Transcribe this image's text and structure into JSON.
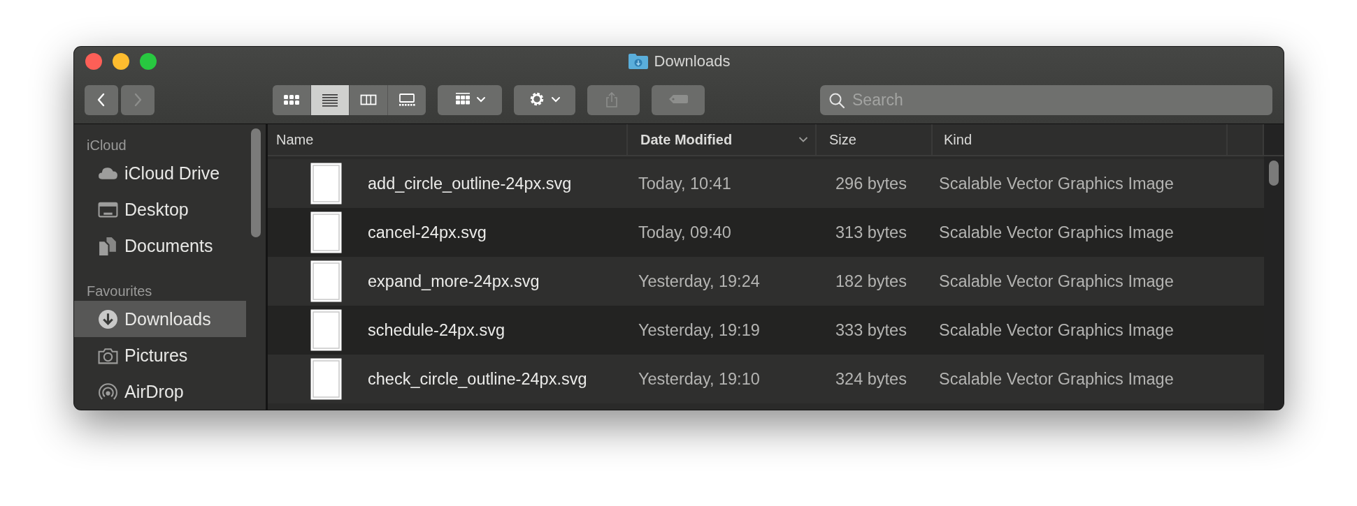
{
  "window": {
    "title": "Downloads"
  },
  "toolbar": {
    "nav": [
      {
        "kind": "back",
        "disabled": false
      },
      {
        "kind": "forward",
        "disabled": true
      }
    ],
    "views": [
      {
        "kind": "icons",
        "selected": false
      },
      {
        "kind": "list",
        "selected": true
      },
      {
        "kind": "columns",
        "selected": false
      },
      {
        "kind": "gallery",
        "selected": false
      }
    ],
    "buttons": [
      {
        "kind": "group",
        "disabled": false
      },
      {
        "kind": "action",
        "disabled": false
      },
      {
        "kind": "share",
        "disabled": true
      },
      {
        "kind": "tag",
        "disabled": true
      }
    ]
  },
  "search": {
    "placeholder": "Search"
  },
  "sidebar": {
    "sections": [
      {
        "title": "iCloud",
        "items": [
          {
            "label": "iCloud Drive",
            "kind": "cloud",
            "selected": false
          },
          {
            "label": "Desktop",
            "kind": "desktop",
            "selected": false
          },
          {
            "label": "Documents",
            "kind": "documents",
            "selected": false
          }
        ]
      },
      {
        "title": "Favourites",
        "items": [
          {
            "label": "Downloads",
            "kind": "downloads",
            "selected": true
          },
          {
            "label": "Pictures",
            "kind": "pictures",
            "selected": false
          },
          {
            "label": "AirDrop",
            "kind": "airdrop",
            "selected": false
          }
        ]
      }
    ]
  },
  "table": {
    "columns": [
      {
        "label": "Name",
        "sorted": false
      },
      {
        "label": "Date Modified",
        "sorted": true
      },
      {
        "label": "Size",
        "sorted": false
      },
      {
        "label": "Kind",
        "sorted": false
      }
    ],
    "rows": [
      {
        "name": "add_circle_outline-24px.svg",
        "date": "Today, 10:41",
        "size": "296 bytes",
        "kind": "Scalable Vector Graphics Image"
      },
      {
        "name": "cancel-24px.svg",
        "date": "Today, 09:40",
        "size": "313 bytes",
        "kind": "Scalable Vector Graphics Image"
      },
      {
        "name": "expand_more-24px.svg",
        "date": "Yesterday, 19:24",
        "size": "182 bytes",
        "kind": "Scalable Vector Graphics Image"
      },
      {
        "name": "schedule-24px.svg",
        "date": "Yesterday, 19:19",
        "size": "333 bytes",
        "kind": "Scalable Vector Graphics Image"
      },
      {
        "name": "check_circle_outline-24px.svg",
        "date": "Yesterday, 19:10",
        "size": "324 bytes",
        "kind": "Scalable Vector Graphics Image"
      }
    ]
  }
}
